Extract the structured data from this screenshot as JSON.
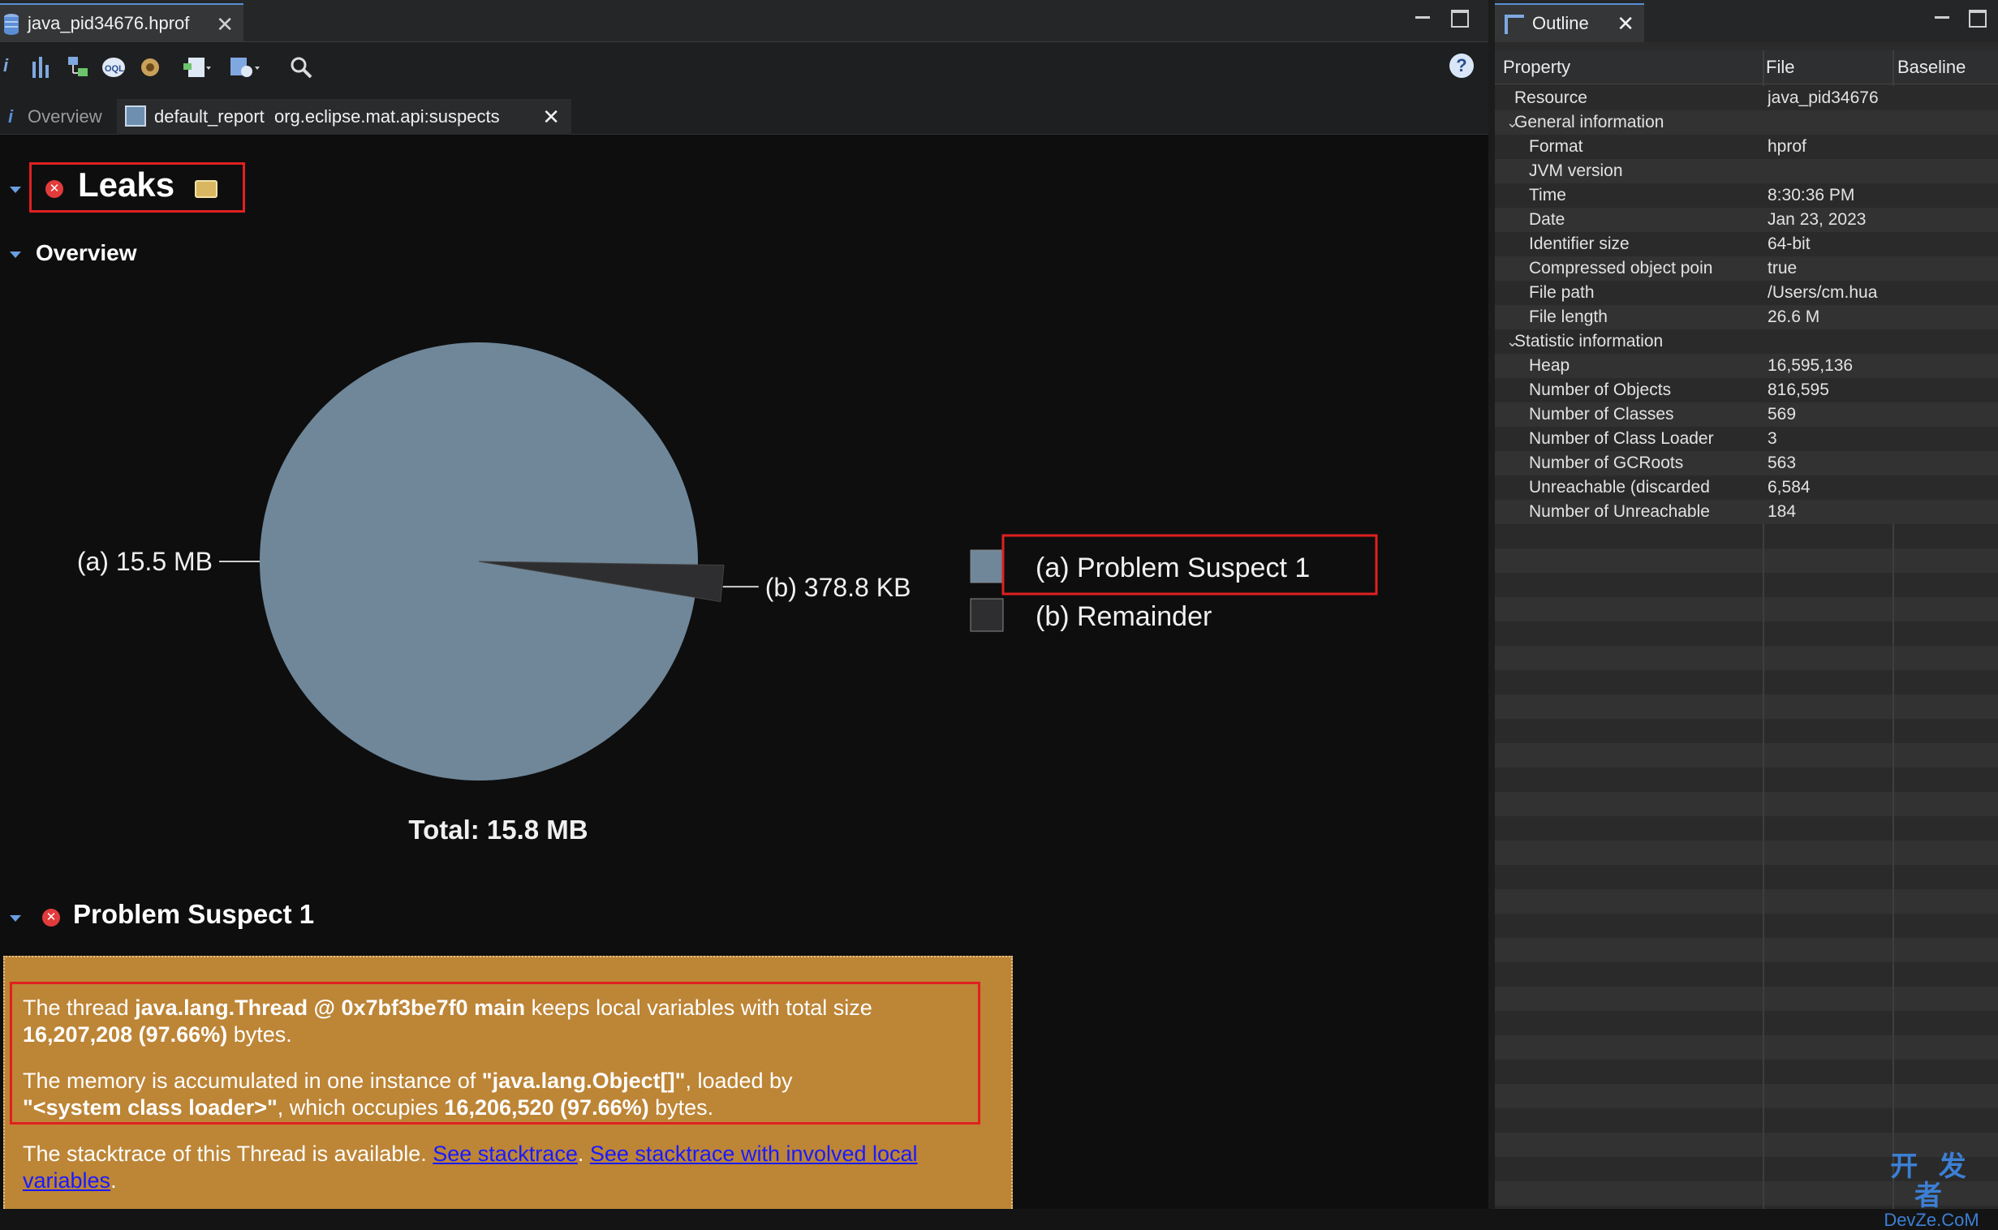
{
  "editor": {
    "tab_label": "java_pid34676.hprof",
    "subtabs": {
      "overview_label": "Overview",
      "report_label": "default_report  org.eclipse.mat.api:suspects"
    }
  },
  "report": {
    "leaks_title": "Leaks",
    "overview_title": "Overview",
    "problem_suspect_title": "Problem Suspect 1",
    "problem_suspect": {
      "p1_a": "The thread ",
      "p1_b": "java.lang.Thread @ 0x7bf3be7f0 main",
      "p1_c": " keeps local variables with total size ",
      "p1_d": "16,207,208 (97.66%)",
      "p1_e": " bytes.",
      "p2_a": "The memory is accumulated in one instance of ",
      "p2_b": "\"java.lang.Object[]\"",
      "p2_c": ", loaded by ",
      "p2_d": "\"<system class loader>\"",
      "p2_e": ", which occupies ",
      "p2_f": "16,206,520 (97.66%)",
      "p2_g": " bytes.",
      "p3_a": "The stacktrace of this Thread is available. ",
      "p3_link1": "See stacktrace",
      "p3_b": ". ",
      "p3_link2": "See stacktrace with involved local variables",
      "p3_c": "."
    }
  },
  "chart_data": {
    "type": "pie",
    "total_label": "Total: 15.8 MB",
    "slices": [
      {
        "key": "(a)",
        "label": "Problem Suspect 1",
        "size_label": "15.5 MB",
        "value": 15.5,
        "color": "#6f8799"
      },
      {
        "key": "(b)",
        "label": "Remainder",
        "size_label": "378.8 KB",
        "value": 0.3788,
        "color": "#2e2e30"
      }
    ]
  },
  "outline": {
    "tab_label": "Outline",
    "columns": [
      "Property",
      "File",
      "Baseline"
    ],
    "rows": [
      {
        "property": "Resource",
        "value": "java_pid34676",
        "level": 0,
        "group": false
      },
      {
        "property": "General information",
        "value": "",
        "level": 0,
        "group": true
      },
      {
        "property": "Format",
        "value": "hprof",
        "level": 1,
        "group": false
      },
      {
        "property": "JVM version",
        "value": "",
        "level": 1,
        "group": false
      },
      {
        "property": "Time",
        "value": "8:30:36 PM",
        "level": 1,
        "group": false
      },
      {
        "property": "Date",
        "value": "Jan 23, 2023",
        "level": 1,
        "group": false
      },
      {
        "property": "Identifier size",
        "value": "64-bit",
        "level": 1,
        "group": false
      },
      {
        "property": "Compressed object poin",
        "value": "true",
        "level": 1,
        "group": false
      },
      {
        "property": "File path",
        "value": "/Users/cm.hua",
        "level": 1,
        "group": false
      },
      {
        "property": "File length",
        "value": "26.6 M",
        "level": 1,
        "group": false
      },
      {
        "property": "Statistic information",
        "value": "",
        "level": 0,
        "group": true
      },
      {
        "property": "Heap",
        "value": "16,595,136",
        "level": 1,
        "group": false
      },
      {
        "property": "Number of Objects",
        "value": "816,595",
        "level": 1,
        "group": false
      },
      {
        "property": "Number of Classes",
        "value": "569",
        "level": 1,
        "group": false
      },
      {
        "property": "Number of Class Loader",
        "value": "3",
        "level": 1,
        "group": false
      },
      {
        "property": "Number of GCRoots",
        "value": "563",
        "level": 1,
        "group": false
      },
      {
        "property": "Unreachable (discarded",
        "value": "6,584",
        "level": 1,
        "group": false
      },
      {
        "property": "Number of Unreachable",
        "value": "184",
        "level": 1,
        "group": false
      }
    ]
  },
  "watermark": {
    "line1": "开 发 者",
    "line2": "DevZe.CoM"
  }
}
